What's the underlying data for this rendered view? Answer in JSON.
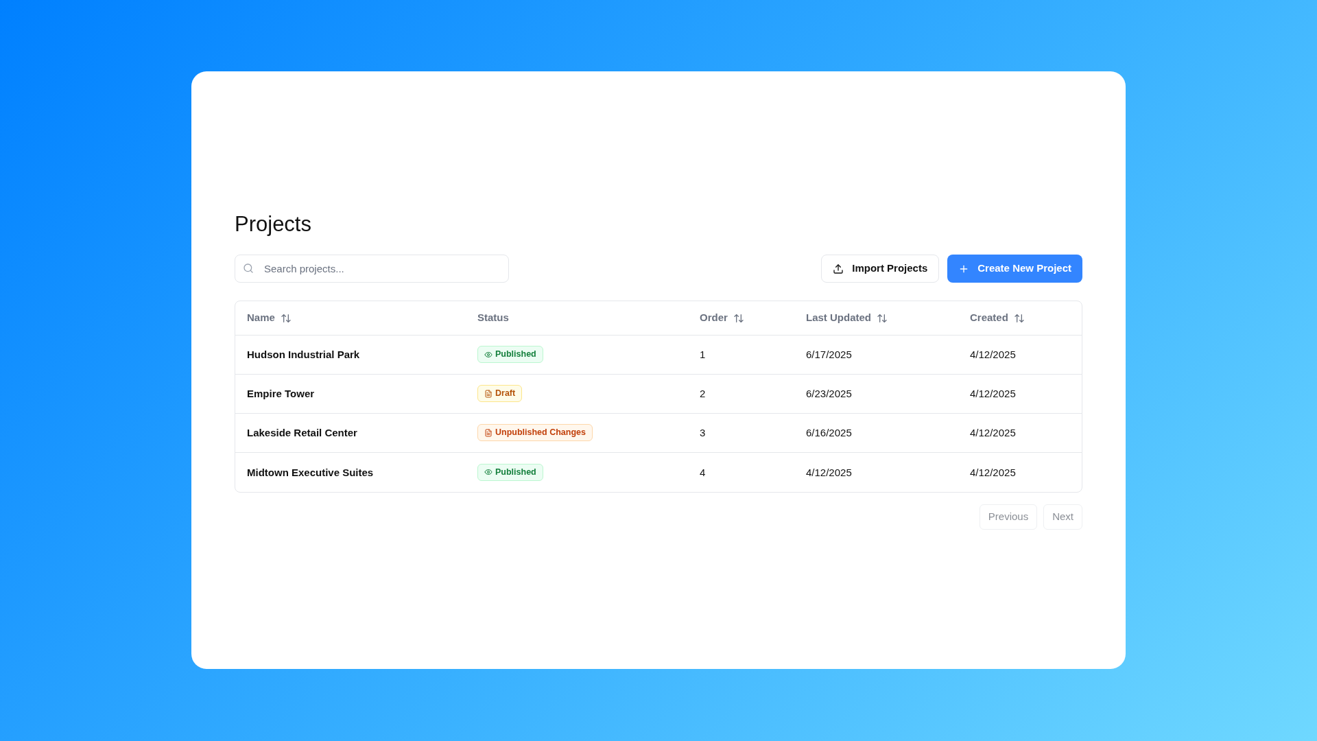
{
  "page": {
    "title": "Projects"
  },
  "search": {
    "placeholder": "Search projects..."
  },
  "actions": [
    {
      "kind": "import",
      "label": "Import Projects"
    },
    {
      "kind": "create",
      "label": "Create New Project"
    }
  ],
  "table": {
    "columns": [
      {
        "label": "Name",
        "sortable": true
      },
      {
        "label": "Status",
        "sortable": false
      },
      {
        "label": "Order",
        "sortable": true
      },
      {
        "label": "Last Updated",
        "sortable": true
      },
      {
        "label": "Created",
        "sortable": true
      }
    ],
    "rows": [
      {
        "name": "Hudson Industrial Park",
        "status": {
          "kind": "published",
          "label": "Published"
        },
        "order": "1",
        "last_updated": "6/17/2025",
        "created": "4/12/2025"
      },
      {
        "name": "Empire Tower",
        "status": {
          "kind": "draft",
          "label": "Draft"
        },
        "order": "2",
        "last_updated": "6/23/2025",
        "created": "4/12/2025"
      },
      {
        "name": "Lakeside Retail Center",
        "status": {
          "kind": "unpublished",
          "label": "Unpublished Changes"
        },
        "order": "3",
        "last_updated": "6/16/2025",
        "created": "4/12/2025"
      },
      {
        "name": "Midtown Executive Suites",
        "status": {
          "kind": "published",
          "label": "Published"
        },
        "order": "4",
        "last_updated": "4/12/2025",
        "created": "4/12/2025"
      }
    ]
  },
  "pagination": [
    {
      "label": "Previous",
      "disabled": true
    },
    {
      "label": "Next",
      "disabled": true
    }
  ]
}
